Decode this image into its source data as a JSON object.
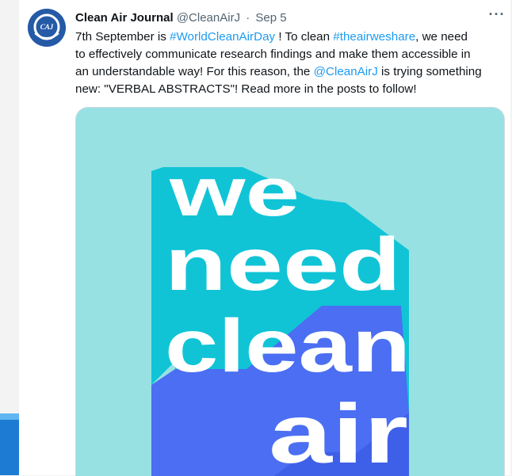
{
  "tweet": {
    "author_name": "Clean Air Journal",
    "author_handle": "@CleanAirJ",
    "separator": "·",
    "date": "Sep 5",
    "more_label": "···",
    "avatar_text": "CAJ",
    "lines": [
      [
        {
          "type": "text",
          "value": "7th September is "
        },
        {
          "type": "link",
          "value": "#WorldCleanAirDay"
        },
        {
          "type": "text",
          "value": " ! To clean "
        },
        {
          "type": "link",
          "value": "#theairweshare"
        },
        {
          "type": "text",
          "value": ", we need"
        }
      ],
      [
        {
          "type": "text",
          "value": "to effectively communicate research findings and make them accessible in"
        }
      ],
      [
        {
          "type": "text",
          "value": "an understandable way! For this reason, the "
        },
        {
          "type": "link",
          "value": "@CleanAirJ"
        },
        {
          "type": "text",
          "value": " is trying something"
        }
      ],
      [
        {
          "type": "text",
          "value": "new: \"VERBAL ABSTRACTS\"! Read more in the posts to follow!"
        }
      ]
    ]
  },
  "media": {
    "words": [
      "we",
      "need",
      "clean",
      "air"
    ]
  },
  "colors": {
    "link": "#1d9bf0",
    "text": "#0f1419",
    "muted": "#536471",
    "image_background": "#97e1e3",
    "image_teal": "#10c4d6",
    "image_purple": "#4b6ef2",
    "image_text": "#ffffff"
  }
}
